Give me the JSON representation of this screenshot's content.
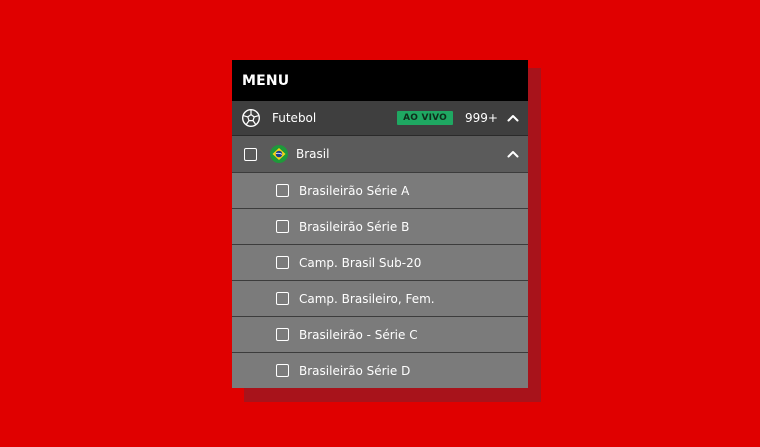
{
  "menu": {
    "title": "MENU"
  },
  "sport": {
    "icon": "soccer-ball-icon",
    "label": "Futebol",
    "live_badge": "AO VIVO",
    "count": "999+",
    "expanded": true
  },
  "country": {
    "flag_icon": "brazil-flag-icon",
    "label": "Brasil",
    "checked": false,
    "expanded": true
  },
  "leagues": [
    {
      "label": "Brasileirão Série A",
      "checked": false
    },
    {
      "label": "Brasileirão Série B",
      "checked": false
    },
    {
      "label": "Camp. Brasil Sub-20",
      "checked": false
    },
    {
      "label": "Camp. Brasileiro, Fem.",
      "checked": false
    },
    {
      "label": "Brasileirão - Série C",
      "checked": false
    },
    {
      "label": "Brasileirão Série D",
      "checked": false
    }
  ],
  "colors": {
    "background": "#e00000",
    "live_badge": "#1fa862",
    "header": "#000000"
  }
}
